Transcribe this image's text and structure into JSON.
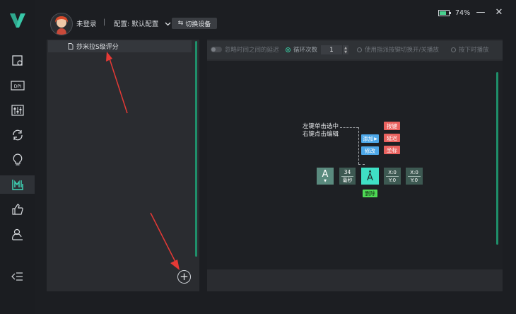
{
  "header": {
    "login_status": "未登录",
    "separator": "|",
    "config_label": "配置: 默认配置",
    "switch_device": "切换设备",
    "battery": "74%",
    "battery_level": 0.74
  },
  "colors": {
    "accent": "#37c49d",
    "scrollbar": "#1f8f6a",
    "red_tag": "#e9625f",
    "blue_tag": "#4da7e8",
    "key_block": "#5a8a7e",
    "key_active": "#3fe0c4",
    "delete_tag": "#4fdc55"
  },
  "sidebar": {
    "items": [
      {
        "icon": "mouse-screen-icon",
        "active": false
      },
      {
        "icon": "dpi-icon",
        "active": false
      },
      {
        "icon": "equalizer-icon",
        "active": false
      },
      {
        "icon": "refresh-icon",
        "active": false
      },
      {
        "icon": "lightbulb-icon",
        "active": false
      },
      {
        "icon": "macro-icon",
        "active": true
      },
      {
        "icon": "thumbs-up-icon",
        "active": false
      },
      {
        "icon": "user-icon",
        "active": false
      }
    ],
    "collapse_icon": "collapse-menu-icon"
  },
  "macro_list": {
    "items": [
      {
        "label": "莎米拉S级评分"
      }
    ],
    "add_icon": "plus-circle-icon"
  },
  "toolbar": {
    "ignore_delay": "忽略时间之间的延迟",
    "loop_count_label": "循环次数",
    "loop_count": "1",
    "toggle_play": "使用指派按键切换开/关播放",
    "hold_play": "按下时播放"
  },
  "editor": {
    "hint_line1": "左键单击选中",
    "hint_line2": "右键点击编辑",
    "add": "添加",
    "modify": "修改",
    "menu": [
      "按键",
      "延迟",
      "坐标"
    ],
    "key1": "A",
    "delay_value": "34",
    "delay_unit": "毫秒",
    "key2": "A",
    "coord1_x": "X:0",
    "coord1_y": "Y:0",
    "coord2_x": "X:0",
    "coord2_y": "Y:0",
    "delete": "删除"
  }
}
